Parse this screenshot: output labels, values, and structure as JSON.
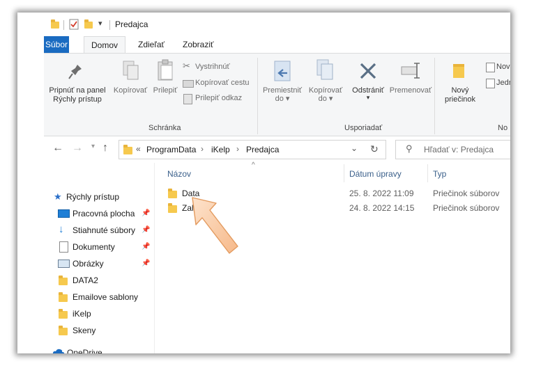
{
  "title": {
    "text": "Predajca"
  },
  "tabs": [
    {
      "label": "Súbor"
    },
    {
      "label": "Domov"
    },
    {
      "label": "Zdieľať"
    },
    {
      "label": "Zobraziť"
    }
  ],
  "ribbon": {
    "pin_line1": "Pripnúť na panel",
    "pin_line2": "Rýchly prístup",
    "copy": "Kopírovať",
    "paste": "Prilepiť",
    "cut": "Vystrihnúť",
    "copy_path": "Kopírovať cestu",
    "paste_shortcut": "Prilepiť odkaz",
    "move_line1": "Premiestniť",
    "move_line2": "do",
    "copyto_line1": "Kopírovať",
    "copyto_line2": "do",
    "delete": "Odstrániť",
    "rename": "Premenovať",
    "new_line1": "Nový",
    "new_line2": "priečinok",
    "new_item": "Nová",
    "easy_access": "Jedn",
    "groups": {
      "clipboard": "Schránka",
      "organize": "Usporiadať",
      "new": "No"
    }
  },
  "address": {
    "prefix": "«",
    "path": [
      "ProgramData",
      "iKelp",
      "Predajca"
    ],
    "separator": "›"
  },
  "search": {
    "placeholder": "Hľadať v: Predajca"
  },
  "nav": {
    "quick_access": "Rýchly prístup",
    "items": [
      {
        "label": "Pracovná plocha",
        "pinned": true
      },
      {
        "label": "Stiahnuté súbory",
        "pinned": true
      },
      {
        "label": "Dokumenty",
        "pinned": true
      },
      {
        "label": "Obrázky",
        "pinned": true
      },
      {
        "label": "DATA2"
      },
      {
        "label": "Emailove sablony"
      },
      {
        "label": "iKelp"
      },
      {
        "label": "Skeny"
      }
    ],
    "onedrive": "OneDrive"
  },
  "columns": {
    "name": "Názov",
    "date": "Dátum úpravy",
    "type": "Typ"
  },
  "files": [
    {
      "name": "Data",
      "date": "25. 8. 2022 11:09",
      "type": "Priečinok súborov"
    },
    {
      "name": "Zalo",
      "date": "24. 8. 2022 14:15",
      "type": "Priečinok súborov"
    }
  ],
  "colors": {
    "accent": "#1a6bc1",
    "folder": "#f6c94e",
    "callout": "#f6b98a"
  }
}
